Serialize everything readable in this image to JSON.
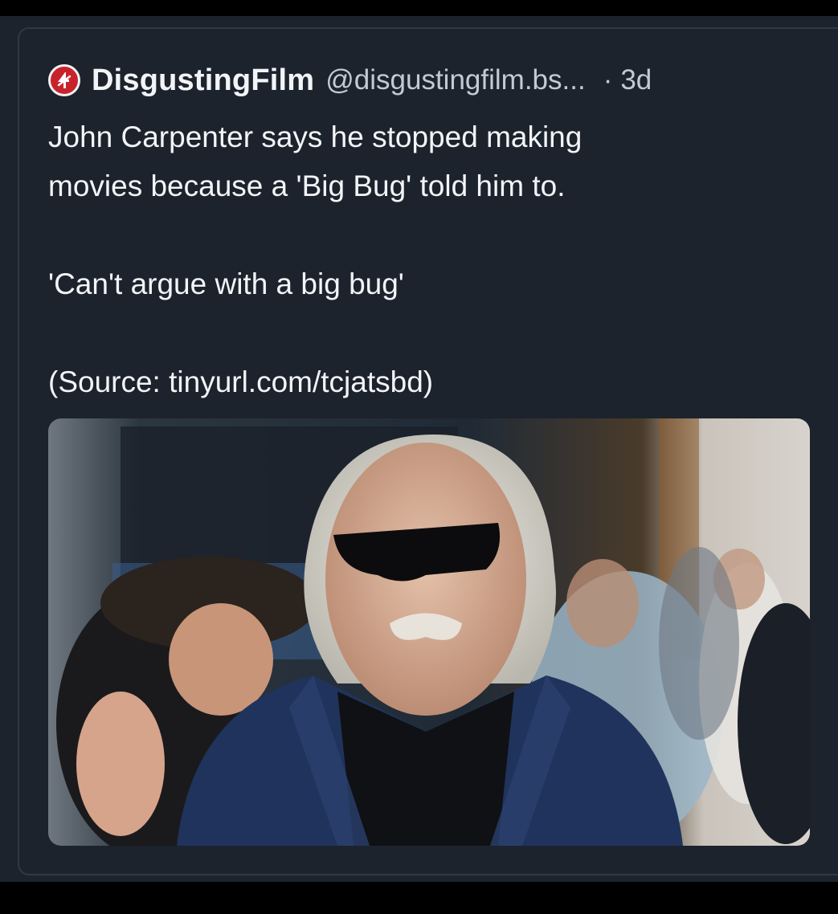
{
  "post": {
    "display_name": "DisgustingFilm",
    "handle": "@disgustingfilm.bs...",
    "separator": "·",
    "time": "3d",
    "text_lines": [
      "John Carpenter says he stopped making",
      "movies because a 'Big Bug' told him to."
    ],
    "quote": "'Can't argue with a big bug'",
    "source": "(Source: tinyurl.com/tcjatsbd)",
    "avatar_icon": "disgustingfilm-logo-icon",
    "image_icon": "photo-of-man-with-sunglasses"
  },
  "colors": {
    "background": "#1c232d",
    "text_primary": "#f2f4f7",
    "text_secondary": "#c3cad4",
    "avatar_red": "#c8232b"
  }
}
